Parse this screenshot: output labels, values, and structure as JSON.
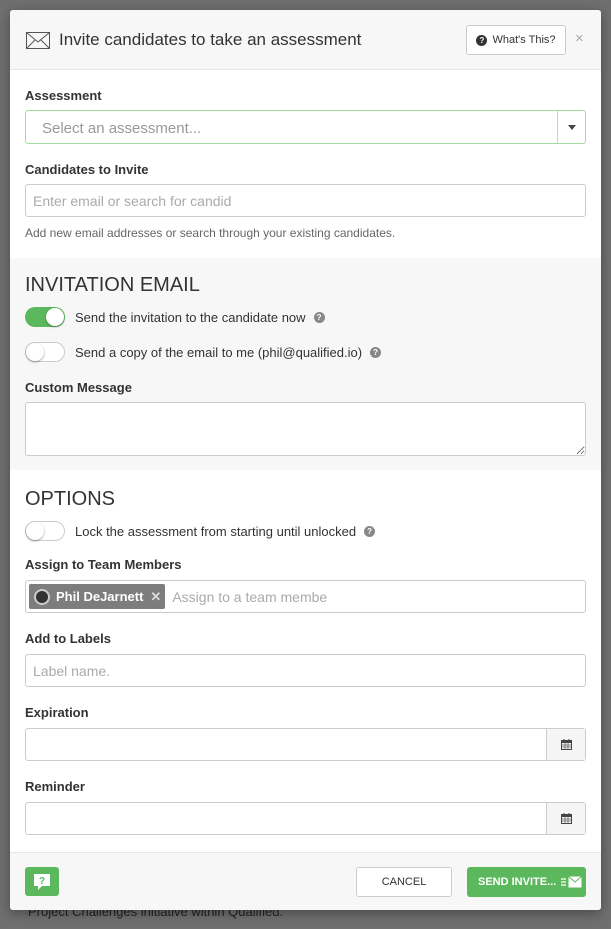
{
  "backdrop": {
    "text": "Project Challenges initiative within Qualified."
  },
  "header": {
    "title": "Invite candidates to take an assessment",
    "whats_this": "What's This?",
    "close": "×"
  },
  "assessment": {
    "label": "Assessment",
    "placeholder": "Select an assessment..."
  },
  "candidates": {
    "label": "Candidates to Invite",
    "placeholder": "Enter email or search for candid",
    "help": "Add new email addresses or search through your existing candidates."
  },
  "invitation": {
    "heading": "INVITATION EMAIL",
    "send_now": {
      "label": "Send the invitation to the candidate now",
      "on": true
    },
    "send_copy": {
      "label": "Send a copy of the email to me (phil@qualified.io)",
      "on": false
    },
    "custom_message_label": "Custom Message",
    "custom_message_value": ""
  },
  "options": {
    "heading": "OPTIONS",
    "lock": {
      "label": "Lock the assessment from starting until unlocked",
      "on": false
    },
    "team_label": "Assign to Team Members",
    "team_tag": "Phil DeJarnett",
    "team_placeholder": "Assign to a team membe",
    "labels_label": "Add to Labels",
    "labels_placeholder": "Label name.",
    "expiration_label": "Expiration",
    "expiration_value": "",
    "reminder_label": "Reminder",
    "reminder_value": ""
  },
  "footer": {
    "cancel": "CANCEL",
    "send": "SEND INVITE..."
  },
  "colors": {
    "accent": "#5cb85c",
    "select_border": "#a6d9a0",
    "tag_bg": "#7d7d7d"
  },
  "icons": [
    "envelope-icon",
    "question-circle-icon",
    "close-icon",
    "caret-down-icon",
    "calendar-icon",
    "help-chat-icon",
    "send-envelope-icon"
  ]
}
